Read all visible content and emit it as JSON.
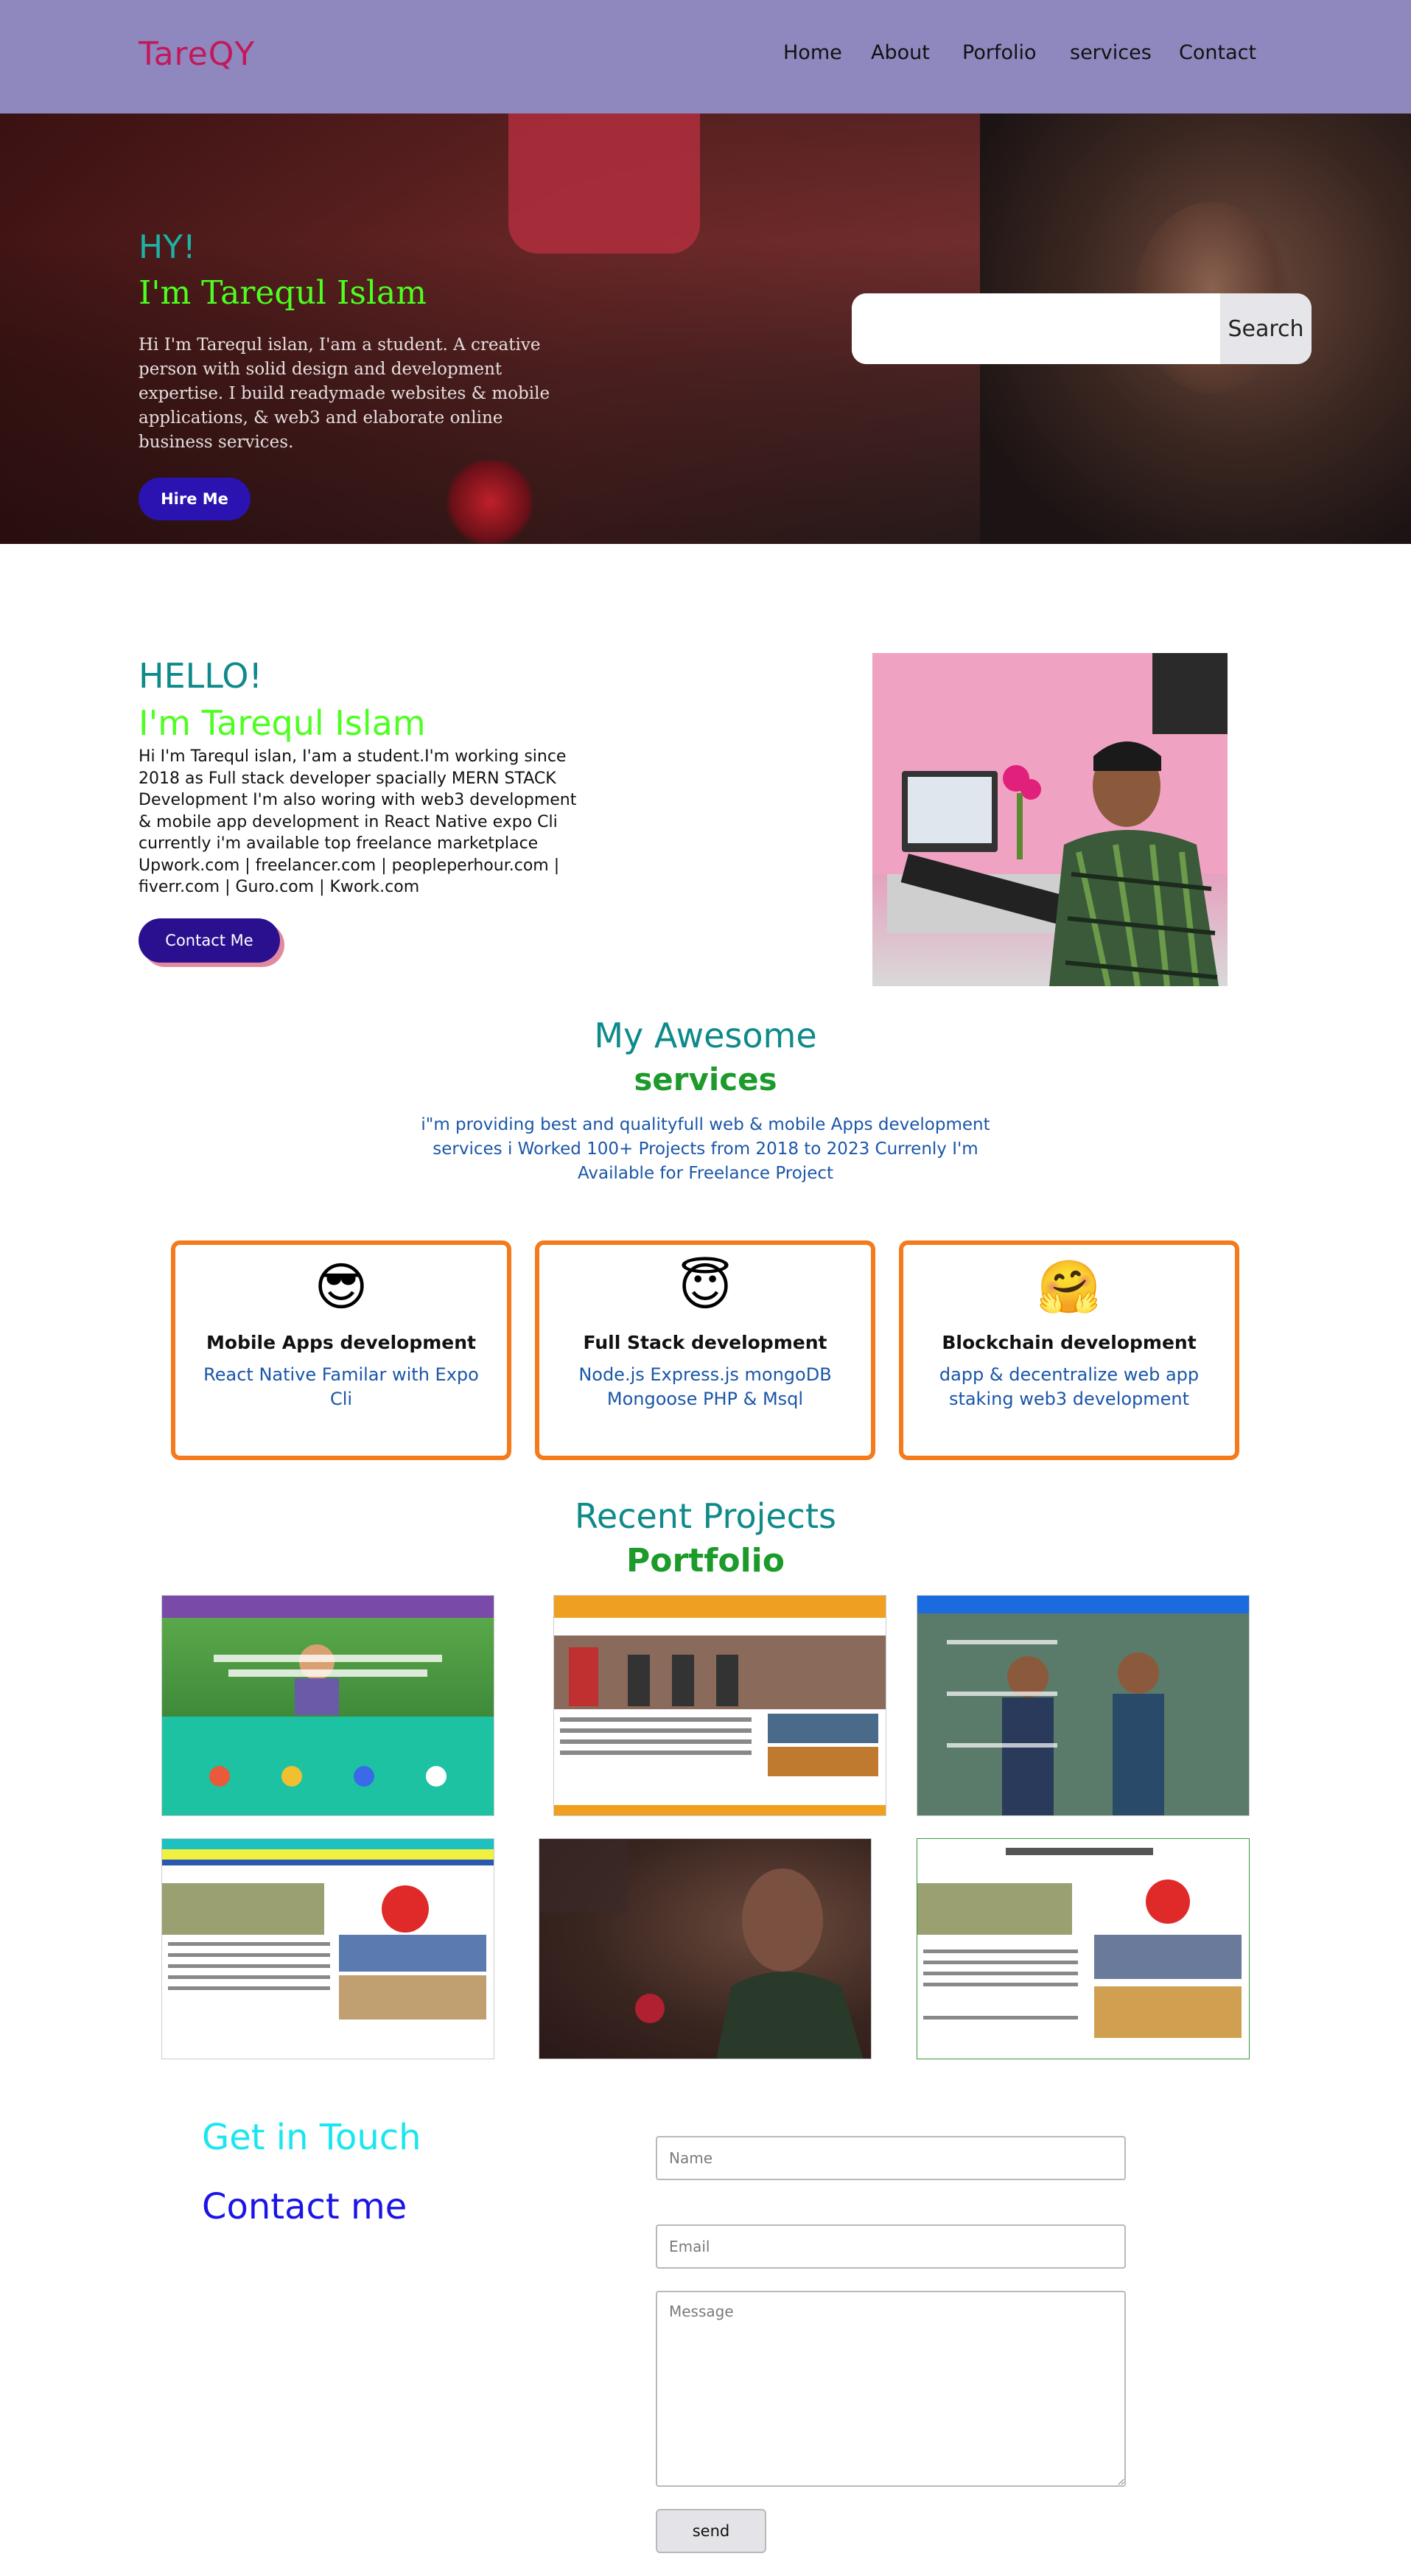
{
  "nav": {
    "logo": "TareQY",
    "links": [
      "Home",
      "About",
      "Porfolio",
      "services",
      "Contact"
    ]
  },
  "hero": {
    "greeting": "HY!",
    "name": "I'm Tarequl Islam",
    "description": "Hi I'm Tarequl islan, I'am a student. A creative person with solid design and development expertise. I build readymade websites & mobile applications, & web3 and elaborate online business services.",
    "hire_button": "Hire Me",
    "search_button": "Search",
    "search_placeholder": ""
  },
  "about": {
    "greeting": "HELLO!",
    "name": "I'm Tarequl Islam",
    "description": "Hi I'm Tarequl islan, I'am a student.I'm working since 2018 as Full stack developer spacially MERN STACK Development I'm also woring with web3 development & mobile app development in React Native expo Cli currently i'm available top freelance marketplace Upwork.com | freelancer.com | peopleperhour.com | fiverr.com | Guro.com | Kwork.com",
    "contact_button": "Contact Me"
  },
  "services": {
    "title": "My Awesome",
    "subtitle": "services",
    "description": "i\"m providing best and qualityfull web & mobile Apps development services i Worked 100+ Projects from 2018 to 2023 Currenly I'm Available for Freelance Project",
    "cards": [
      {
        "icon": "sunglasses-emoji-icon",
        "emoji": "😎",
        "title": "Mobile Apps development",
        "desc": "React Native Familar with Expo Cli"
      },
      {
        "icon": "halo-emoji-icon",
        "emoji": "😇",
        "title": "Full Stack development",
        "desc": "Node.js Express.js mongoDB Mongoose PHP & Msql"
      },
      {
        "icon": "hugging-emoji-icon",
        "emoji": "🤗",
        "title": "Blockchain development",
        "desc": "dapp & decentralize web app staking web3 development"
      }
    ]
  },
  "portfolio": {
    "title": "Recent Projects",
    "subtitle": "Portfolio"
  },
  "contact": {
    "heading1": "Get in Touch",
    "heading2": "Contact me",
    "name_placeholder": "Name",
    "email_placeholder": "Email",
    "message_placeholder": "Message",
    "send_button": "send"
  },
  "colors": {
    "nav_bg": "#8f88be",
    "accent_teal": "#0e8a8a",
    "accent_green": "#4cff1f",
    "card_border": "#f47a1c",
    "button_purple": "#2a13b0"
  }
}
